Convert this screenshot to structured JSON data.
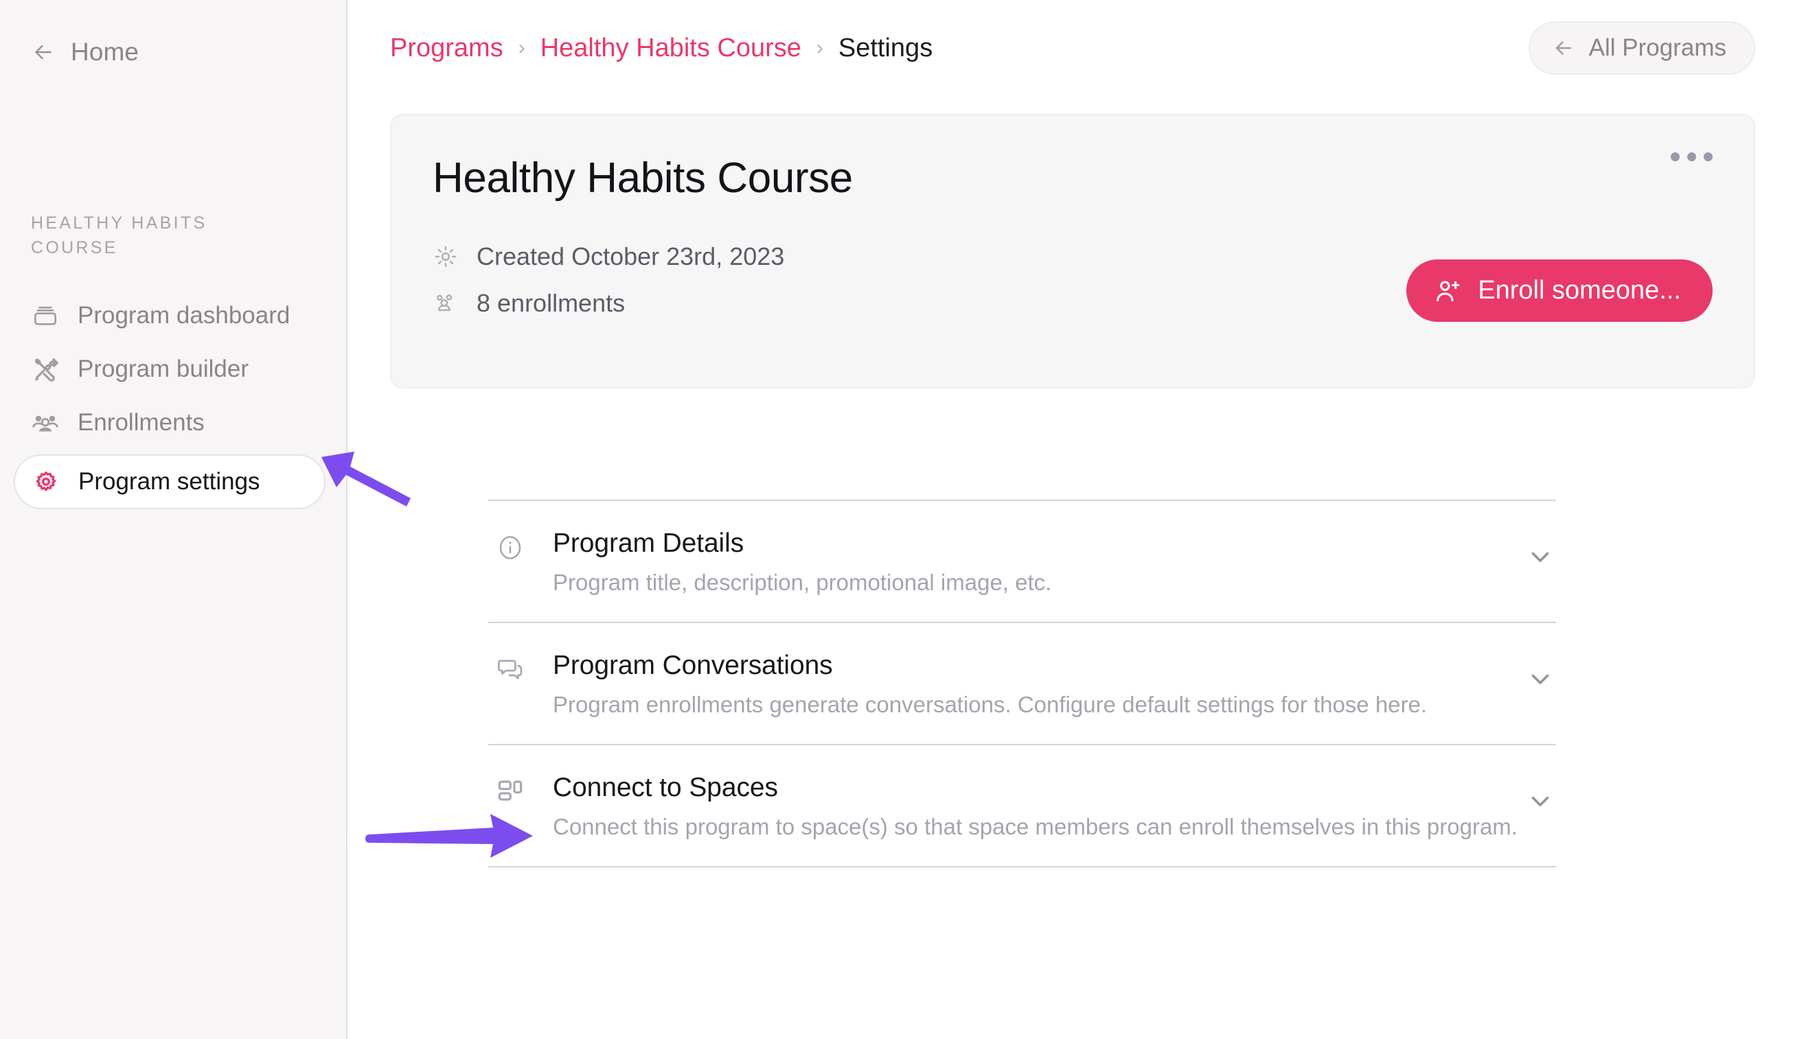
{
  "sidebar": {
    "back_label": "Home",
    "back_icon": "arrow-left-icon",
    "section_label": "HEALTHY HABITS COURSE",
    "items": [
      {
        "label": "Program dashboard",
        "icon": "dashboard-icon",
        "active": false
      },
      {
        "label": "Program builder",
        "icon": "tools-icon",
        "active": false
      },
      {
        "label": "Enrollments",
        "icon": "people-group-icon",
        "active": false
      },
      {
        "label": "Program settings",
        "icon": "gear-icon",
        "active": true
      }
    ]
  },
  "topbar": {
    "breadcrumb": [
      {
        "label": "Programs",
        "current": false
      },
      {
        "label": "Healthy Habits Course",
        "current": false
      },
      {
        "label": "Settings",
        "current": true
      }
    ],
    "separator": "›",
    "all_programs_label": "All Programs",
    "all_programs_icon": "arrow-left-icon"
  },
  "program_card": {
    "title": "Healthy Habits Course",
    "meta": [
      {
        "icon": "sun-icon",
        "text": "Created October 23rd, 2023"
      },
      {
        "icon": "people-icon",
        "text": "8 enrollments"
      }
    ],
    "enroll_button": {
      "label": "Enroll someone...",
      "icon": "user-plus-icon"
    },
    "overflow_icon": "ellipsis-icon"
  },
  "settings_sections": [
    {
      "icon": "info-circle-icon",
      "title": "Program Details",
      "description": "Program title, description, promotional image, etc.",
      "chevron": "chevron-down-icon"
    },
    {
      "icon": "conversations-icon",
      "title": "Program Conversations",
      "description": "Program enrollments generate conversations. Configure default settings for those here.",
      "chevron": "chevron-down-icon"
    },
    {
      "icon": "layout-spaces-icon",
      "title": "Connect to Spaces",
      "description": "Connect this program to space(s) so that space members can enroll themselves in this program.",
      "chevron": "chevron-down-icon"
    }
  ],
  "annotations": [
    {
      "name": "arrow-pointing-to-program-settings",
      "color": "#7c4dee",
      "direction": "up-left"
    },
    {
      "name": "arrow-pointing-to-connect-to-spaces",
      "color": "#7c4dee",
      "direction": "right"
    }
  ],
  "colors": {
    "accent_pink": "#e8396a",
    "annotation_purple": "#7c4dee",
    "sidebar_bg": "#f7f5f6",
    "card_bg": "#f7f6f7",
    "muted_text": "#8c8288"
  }
}
